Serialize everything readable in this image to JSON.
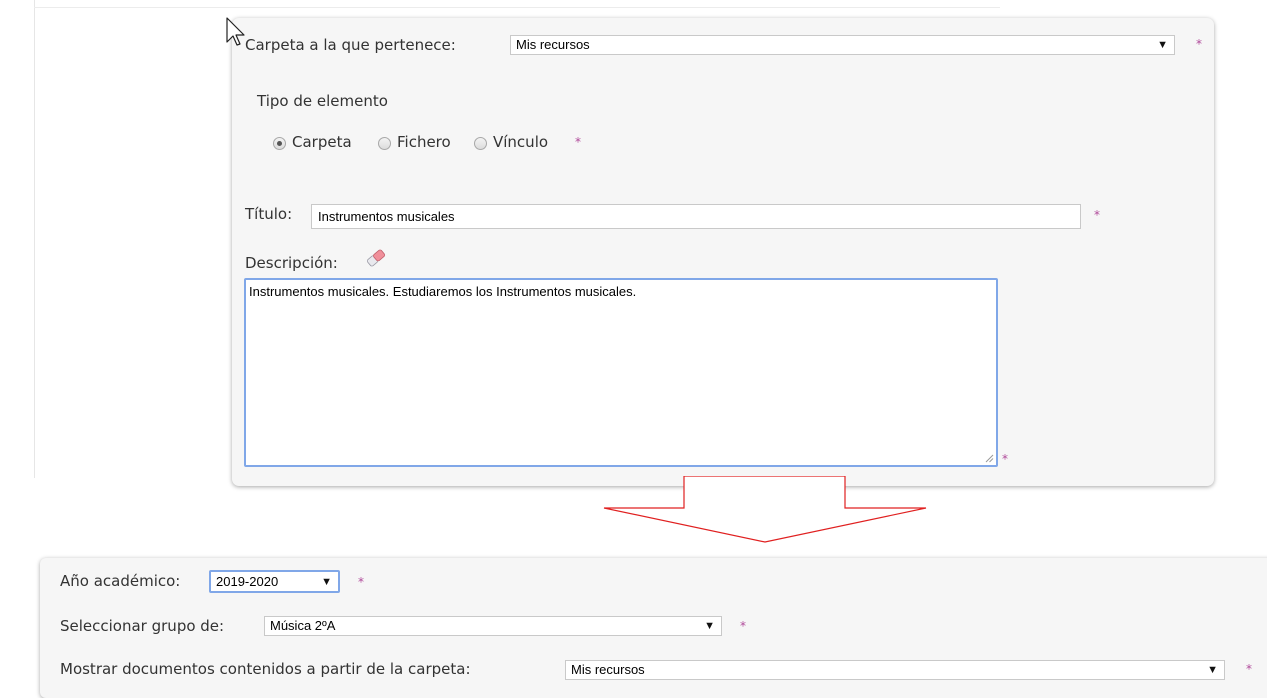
{
  "form": {
    "folder_label": "Carpeta a la que pertenece:",
    "folder_value": "Mis recursos",
    "required_mark": "*",
    "element_type_label": "Tipo de elemento",
    "type_options": [
      "Carpeta",
      "Fichero",
      "Vínculo"
    ],
    "selected_type": "Carpeta",
    "title_label": "Título:",
    "title_value": "Instrumentos musicales",
    "description_label": "Descripción:",
    "description_value": "Instrumentos musicales. Estudiaremos los Instrumentos musicales."
  },
  "filters": {
    "year_label": "Año académico:",
    "year_value": "2019-2020",
    "group_label": "Seleccionar grupo de:",
    "group_value": "Música 2ºA",
    "folder_label": "Mostrar documentos contenidos a partir de la carpeta:",
    "folder_value": "Mis recursos"
  },
  "icons": {
    "pointer": "mouse-pointer-icon",
    "eraser": "eraser-icon",
    "dropdown": "dropdown-arrow-icon",
    "arrow": "down-arrow-icon"
  },
  "colors": {
    "required": "#b04a9a",
    "focus_border": "#80a7e8",
    "arrow": "#e02020"
  }
}
